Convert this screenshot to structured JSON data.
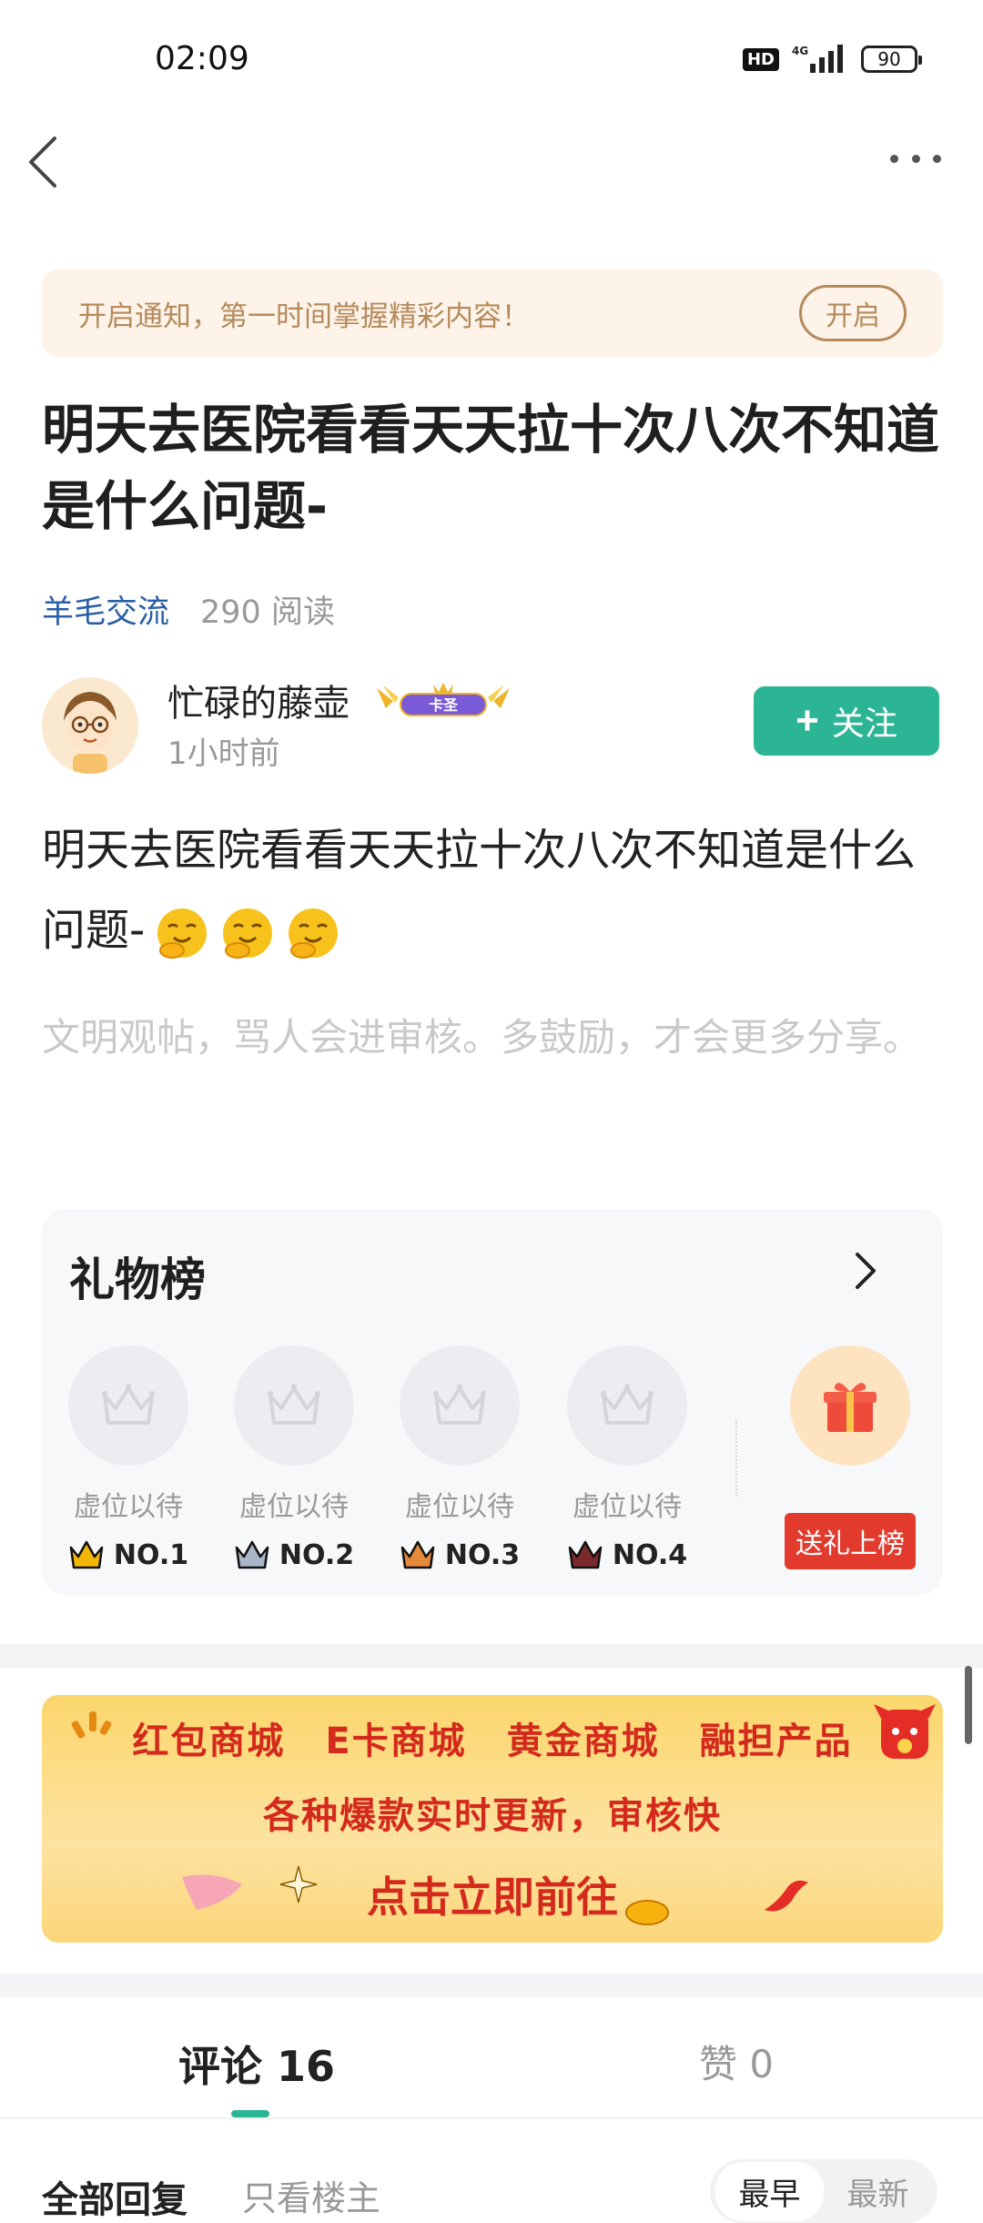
{
  "status_bar": {
    "time": "02:09",
    "hd": "HD",
    "network": "4G",
    "battery": "90"
  },
  "notice": {
    "text": "开启通知，第一时间掌握精彩内容！",
    "button": "开启"
  },
  "post": {
    "title": "明天去医院看看天天拉十次八次不知道是什么问题-",
    "category": "羊毛交流",
    "reads": "290 阅读",
    "content": "明天去医院看看天天拉十次八次不知道是什么问题-",
    "hint": "文明观帖，骂人会进审核。多鼓励，才会更多分享。"
  },
  "author": {
    "name": "忙碌的藤壶",
    "badge": "卡圣",
    "time": "1小时前",
    "follow": "关注"
  },
  "gift_board": {
    "title": "礼物榜",
    "slots": [
      {
        "label": "虚位以待",
        "rank": "NO.1",
        "color": "#f2b705"
      },
      {
        "label": "虚位以待",
        "rank": "NO.2",
        "color": "#a8b6c8"
      },
      {
        "label": "虚位以待",
        "rank": "NO.3",
        "color": "#e5893a"
      },
      {
        "label": "虚位以待",
        "rank": "NO.4",
        "color": "#7a2a2a"
      }
    ],
    "send_button": "送礼上榜"
  },
  "promo": {
    "items": [
      "红包商城",
      "E卡商城",
      "黄金商城",
      "融担产品"
    ],
    "line2": "各种爆款实时更新，审核快",
    "cta": "点击立即前往"
  },
  "tabs": {
    "comments_label": "评论",
    "comments_count": "16",
    "likes": "赞 0"
  },
  "filters": {
    "all": "全部回复",
    "author_only": "只看楼主",
    "sort_hot": "最早",
    "sort_new": "最新"
  },
  "colors": {
    "accent": "#2cb594",
    "link": "#2a5ea6",
    "notice_text": "#b58a5c",
    "promo_red": "#d42a1d"
  }
}
